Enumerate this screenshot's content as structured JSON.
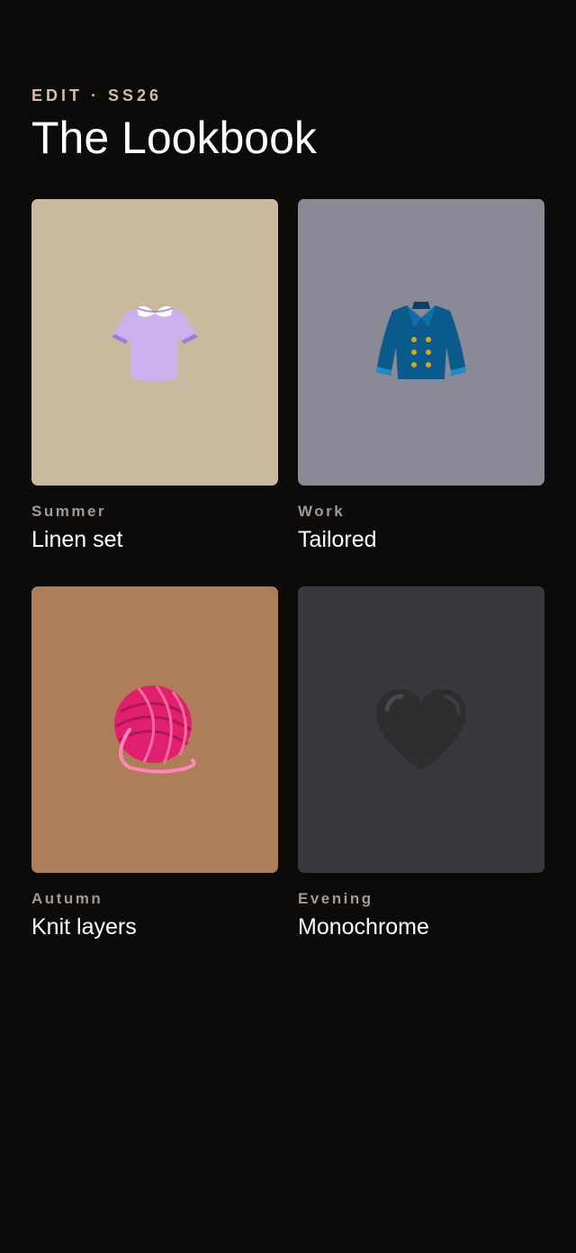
{
  "header": {
    "eyebrow": "EDIT · SS26",
    "title": "The Lookbook"
  },
  "looks": [
    {
      "category": "Summer",
      "name": "Linen set",
      "icon": "blouse-icon",
      "tile_color": "#c9b99e"
    },
    {
      "category": "Work",
      "name": "Tailored",
      "icon": "coat-icon",
      "tile_color": "#898a96"
    },
    {
      "category": "Autumn",
      "name": "Knit layers",
      "icon": "yarn-icon",
      "tile_color": "#ad7e57"
    },
    {
      "category": "Evening",
      "name": "Monochrome",
      "icon": "black-heart-icon",
      "tile_color": "#39383e"
    }
  ],
  "colors": {
    "background": "#0c0b0a",
    "eyebrow": "#d2bea4",
    "category": "#a39a8e",
    "text": "#ffffff"
  }
}
